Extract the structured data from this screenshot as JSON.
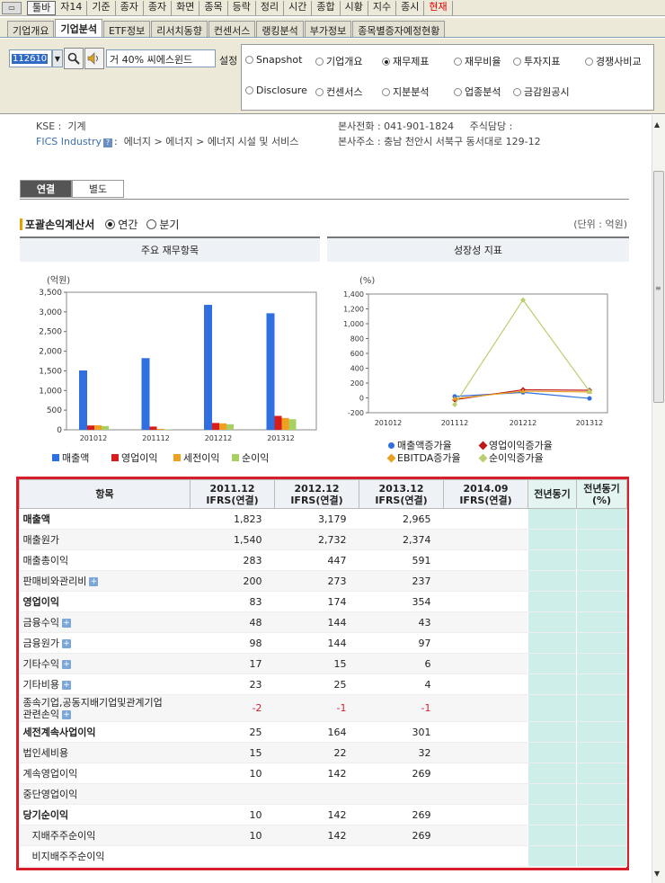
{
  "menubar": {
    "items": [
      "툴바",
      "자14",
      "기준",
      "종자",
      "종자",
      "화면",
      "종목",
      "등락",
      "정리",
      "시간",
      "종합",
      "시황",
      "지수",
      "종시",
      "현재"
    ]
  },
  "tabs": [
    "기업개요",
    "기업분석",
    "ETF정보",
    "리서치동향",
    "컨센서스",
    "랭킹분석",
    "부가정보",
    "종목별증자예정현황"
  ],
  "toolbar": {
    "code": "112610",
    "prefix": "거 40%",
    "name": "씨에스윈드",
    "settings_label": "설정"
  },
  "options": {
    "row1": [
      "Snapshot",
      "기업개요",
      "재무제표",
      "재무비율",
      "투자지표",
      "경쟁사비교"
    ],
    "row2": [
      "Disclosure",
      "컨센서스",
      "지분분석",
      "업종분석",
      "금감원공시"
    ],
    "selected": "재무제표"
  },
  "company": {
    "kse_label": "KSE :",
    "kse_value": "기계",
    "fics_label": "FICS Industry",
    "fics_value": "에너지 > 에너지 > 에너지 시설 및 서비스",
    "phone": "본사전화 :  041-901-1824",
    "ir_contact": "주식담당 :",
    "address": "본사주소 :  충남 천안시 서북구 동서대로 129-12"
  },
  "view_tabs": {
    "consolidated": "연결",
    "separate": "별도"
  },
  "statement": {
    "title": "포괄손익계산서",
    "annual": "연간",
    "quarterly": "분기",
    "unit": "(단위 : 억원)"
  },
  "panels": {
    "left": "주요 재무항목",
    "right": "성장성 지표"
  },
  "chart_data": [
    {
      "type": "bar",
      "ylabel": "(억원)",
      "ylim": [
        0,
        3500
      ],
      "yticks": [
        "3,500",
        "3,000",
        "2,500",
        "2,000",
        "1,500",
        "1,000",
        "500",
        "0"
      ],
      "categories": [
        "201012",
        "201112",
        "201212",
        "201312"
      ],
      "series": [
        {
          "name": "매출액",
          "color": "#2f6fe0",
          "values": [
            1510,
            1823,
            3179,
            2965
          ]
        },
        {
          "name": "영업이익",
          "color": "#d91c1c",
          "values": [
            110,
            83,
            174,
            354
          ]
        },
        {
          "name": "세전이익",
          "color": "#f0a020",
          "values": [
            115,
            25,
            164,
            301
          ]
        },
        {
          "name": "순이익",
          "color": "#a8d060",
          "values": [
            95,
            10,
            142,
            269
          ]
        }
      ]
    },
    {
      "type": "line",
      "ylabel": "(%)",
      "ylim": [
        -200,
        1400
      ],
      "yticks": [
        "1,400",
        "1,200",
        "1,000",
        "800",
        "600",
        "400",
        "200",
        "0",
        "-200"
      ],
      "categories": [
        "201012",
        "201112",
        "201212",
        "201312"
      ],
      "series": [
        {
          "name": "매출액증가율",
          "color": "#2f6fe0",
          "values": [
            null,
            20,
            74,
            -7
          ]
        },
        {
          "name": "영업이익증가율",
          "color": "#c01818",
          "values": [
            null,
            -25,
            110,
            103
          ]
        },
        {
          "name": "EBITDA증가율",
          "color": "#e8a020",
          "values": [
            null,
            -10,
            90,
            80
          ]
        },
        {
          "name": "순이익증가율",
          "color": "#b8d070",
          "values": [
            null,
            -89,
            1320,
            89
          ]
        }
      ]
    }
  ],
  "table": {
    "headers": [
      "항목",
      "2011.12\nIFRS(연결)",
      "2012.12\nIFRS(연결)",
      "2013.12\nIFRS(연결)",
      "2014.09\nIFRS(연결)",
      "전년동기",
      "전년동기\n(%)"
    ],
    "rows": [
      {
        "label": "매출액",
        "bold": true,
        "plus": false,
        "v": [
          "1,823",
          "3,179",
          "2,965"
        ]
      },
      {
        "label": "매출원가",
        "bold": false,
        "plus": false,
        "v": [
          "1,540",
          "2,732",
          "2,374"
        ]
      },
      {
        "label": "매출총이익",
        "bold": false,
        "plus": false,
        "v": [
          "283",
          "447",
          "591"
        ]
      },
      {
        "label": "판매비와관리비",
        "bold": false,
        "plus": true,
        "v": [
          "200",
          "273",
          "237"
        ]
      },
      {
        "label": "영업이익",
        "bold": true,
        "plus": false,
        "v": [
          "83",
          "174",
          "354"
        ]
      },
      {
        "label": "금융수익",
        "bold": false,
        "plus": true,
        "v": [
          "48",
          "144",
          "43"
        ]
      },
      {
        "label": "금융원가",
        "bold": false,
        "plus": true,
        "v": [
          "98",
          "144",
          "97"
        ]
      },
      {
        "label": "기타수익",
        "bold": false,
        "plus": true,
        "v": [
          "17",
          "15",
          "6"
        ]
      },
      {
        "label": "기타비용",
        "bold": false,
        "plus": true,
        "v": [
          "23",
          "25",
          "4"
        ]
      },
      {
        "label": "종속기업,공동지배기업및관계기업\n관련손익",
        "bold": false,
        "plus": true,
        "neg": true,
        "v": [
          "-2",
          "-1",
          "-1"
        ]
      },
      {
        "label": "세전계속사업이익",
        "bold": true,
        "plus": false,
        "v": [
          "25",
          "164",
          "301"
        ]
      },
      {
        "label": "법인세비용",
        "bold": false,
        "plus": false,
        "v": [
          "15",
          "22",
          "32"
        ]
      },
      {
        "label": "계속영업이익",
        "bold": false,
        "plus": false,
        "v": [
          "10",
          "142",
          "269"
        ]
      },
      {
        "label": "중단영업이익",
        "bold": false,
        "plus": false,
        "v": [
          "",
          "",
          ""
        ]
      },
      {
        "label": "당기순이익",
        "bold": true,
        "plus": false,
        "v": [
          "10",
          "142",
          "269"
        ]
      },
      {
        "label": "지배주주순이익",
        "bold": false,
        "plus": false,
        "indent": true,
        "v": [
          "10",
          "142",
          "269"
        ]
      },
      {
        "label": "비지배주주순이익",
        "bold": false,
        "plus": false,
        "indent": true,
        "v": [
          "",
          "",
          ""
        ]
      }
    ]
  }
}
